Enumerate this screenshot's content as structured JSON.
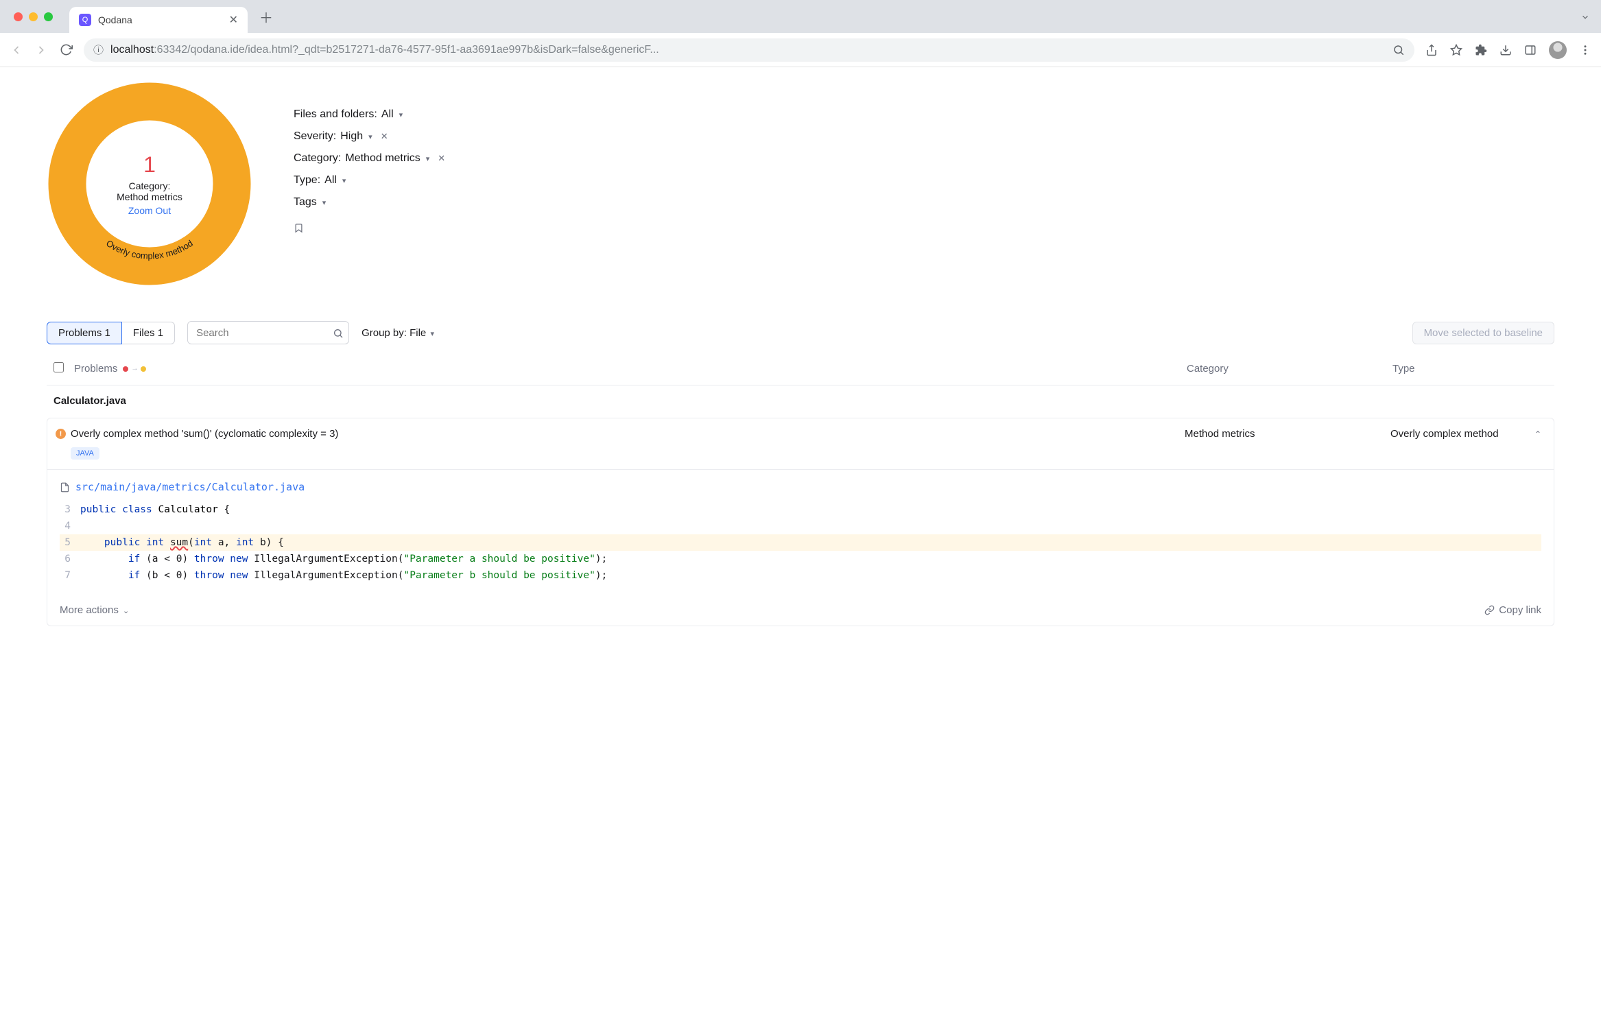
{
  "browser": {
    "tab_title": "Qodana",
    "url_host": "localhost",
    "url_path": ":63342/qodana.ide/idea.html?_qdt=b2517271-da76-4577-95f1-aa3691ae997b&isDark=false&genericF..."
  },
  "chart_data": {
    "type": "pie",
    "title": "",
    "categories": [
      "Overly complex method"
    ],
    "values": [
      1
    ],
    "colors": [
      "#f5a623"
    ]
  },
  "donut": {
    "count": "1",
    "category_label": "Category:",
    "category_value": "Method metrics",
    "zoom_label": "Zoom Out",
    "arc_label": "Overly complex method"
  },
  "filters": {
    "files_label": "Files and folders:",
    "files_value": "All",
    "severity_label": "Severity:",
    "severity_value": "High",
    "category_label": "Category:",
    "category_value": "Method metrics",
    "type_label": "Type:",
    "type_value": "All",
    "tags_label": "Tags"
  },
  "tabs": {
    "problems_label": "Problems 1",
    "files_label": "Files 1",
    "search_placeholder": "Search",
    "groupby_label": "Group by: File",
    "baseline_label": "Move selected to baseline"
  },
  "table": {
    "col_problems": "Problems",
    "col_category": "Category",
    "col_type": "Type"
  },
  "file_group": "Calculator.java",
  "issue": {
    "title": "Overly complex method 'sum()' (cyclomatic complexity = 3)",
    "category": "Method metrics",
    "type": "Overly complex method",
    "lang_tag": "JAVA",
    "filepath": "src/main/java/metrics/Calculator.java"
  },
  "code": {
    "lines": [
      {
        "n": "3",
        "hl": false,
        "tokens": [
          [
            "kw-blue",
            "public class "
          ],
          [
            "type",
            "Calculator "
          ],
          [
            "punc",
            "{"
          ]
        ]
      },
      {
        "n": "4",
        "hl": false,
        "tokens": []
      },
      {
        "n": "5",
        "hl": true,
        "tokens": [
          [
            "pad",
            "    "
          ],
          [
            "kw-blue",
            "public int "
          ],
          [
            "redunder",
            "sum"
          ],
          [
            "punc",
            "("
          ],
          [
            "kw-blue",
            "int"
          ],
          [
            "punc",
            " a, "
          ],
          [
            "kw-blue",
            "int"
          ],
          [
            "punc",
            " b) {"
          ]
        ]
      },
      {
        "n": "6",
        "hl": false,
        "tokens": [
          [
            "pad",
            "        "
          ],
          [
            "kw-blue",
            "if"
          ],
          [
            "punc",
            " (a < "
          ],
          [
            "punc",
            "0"
          ],
          [
            "punc",
            ") "
          ],
          [
            "kw-blue",
            "throw new"
          ],
          [
            "punc",
            " IllegalArgumentException("
          ],
          [
            "str",
            "\"Parameter a should be positive\""
          ],
          [
            "punc",
            ");"
          ]
        ]
      },
      {
        "n": "7",
        "hl": false,
        "tokens": [
          [
            "pad",
            "        "
          ],
          [
            "kw-blue",
            "if"
          ],
          [
            "punc",
            " (b < "
          ],
          [
            "punc",
            "0"
          ],
          [
            "punc",
            ") "
          ],
          [
            "kw-blue",
            "throw new"
          ],
          [
            "punc",
            " IllegalArgumentException("
          ],
          [
            "str",
            "\"Parameter b should be positive\""
          ],
          [
            "punc",
            ");"
          ]
        ]
      }
    ]
  },
  "footer": {
    "more_actions": "More actions",
    "copy_link": "Copy link"
  }
}
